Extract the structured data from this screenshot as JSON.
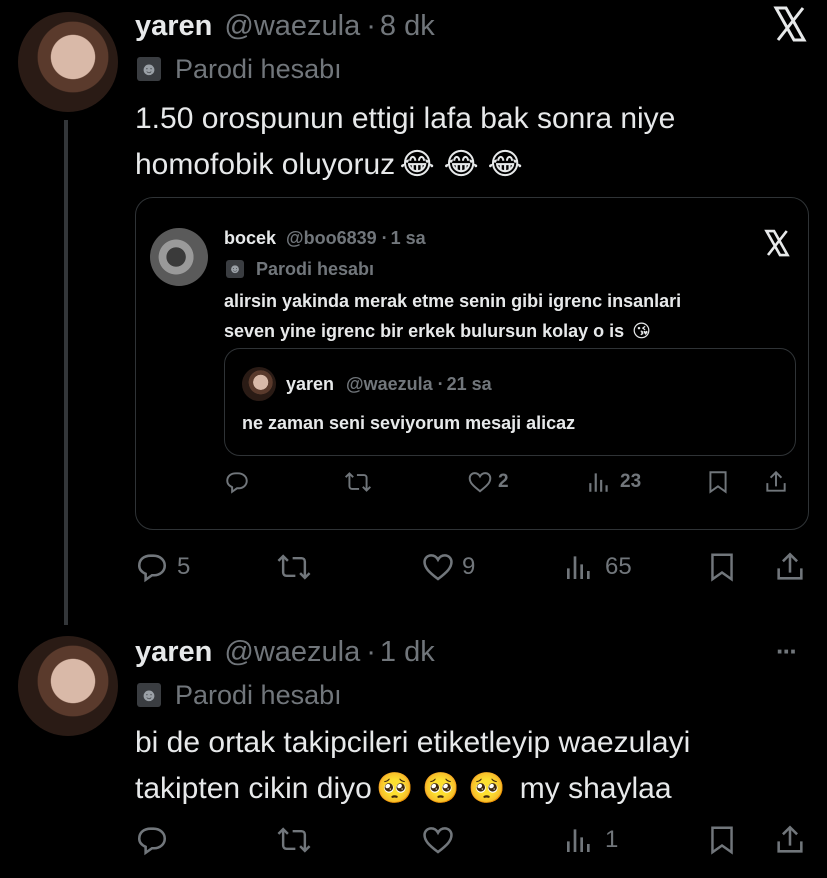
{
  "tweet1": {
    "display_name": "yaren",
    "handle": "@waezula",
    "sep": "·",
    "time": "8 dk",
    "parody_label": "Parodi hesabı",
    "text_line1": "1.50 orospunun ettigi lafa bak sonra niye",
    "text_line2": "homofobik oluyoruz",
    "emojis": [
      "😂",
      "😂",
      "😂"
    ],
    "replies": "5",
    "likes": "9",
    "views": "65"
  },
  "quote": {
    "display_name": "bocek",
    "handle": "@boo6839",
    "sep": "·",
    "time": "1 sa",
    "parody_label": "Parodi hesabı",
    "text_line1": "alirsin yakinda merak etme senin gibi igrenc insanlari",
    "text_line2": "seven yine igrenc bir erkek bulursun kolay o is",
    "emoji": "😘",
    "likes": "2",
    "views": "23"
  },
  "nested_quote": {
    "display_name": "yaren",
    "handle": "@waezula",
    "sep": "·",
    "time": "21 sa",
    "text": "ne zaman seni seviyorum mesaji alicaz"
  },
  "tweet2": {
    "display_name": "yaren",
    "handle": "@waezula",
    "sep": "·",
    "time": "1 dk",
    "parody_label": "Parodi hesabı",
    "text_line1": "bi de ortak takipcileri etiketleyip waezulayi",
    "text_line2": "takipten cikin diyo",
    "emojis": [
      "🥺",
      "🥺",
      "🥺"
    ],
    "text_tail": "my shaylaa",
    "views": "1",
    "more": "···"
  },
  "icons": {
    "x_logo": "X",
    "mask": "theater-mask-icon"
  },
  "colors": {
    "background": "#000000",
    "text": "#e7e9ea",
    "muted": "#71767b",
    "border": "#2f3336"
  }
}
